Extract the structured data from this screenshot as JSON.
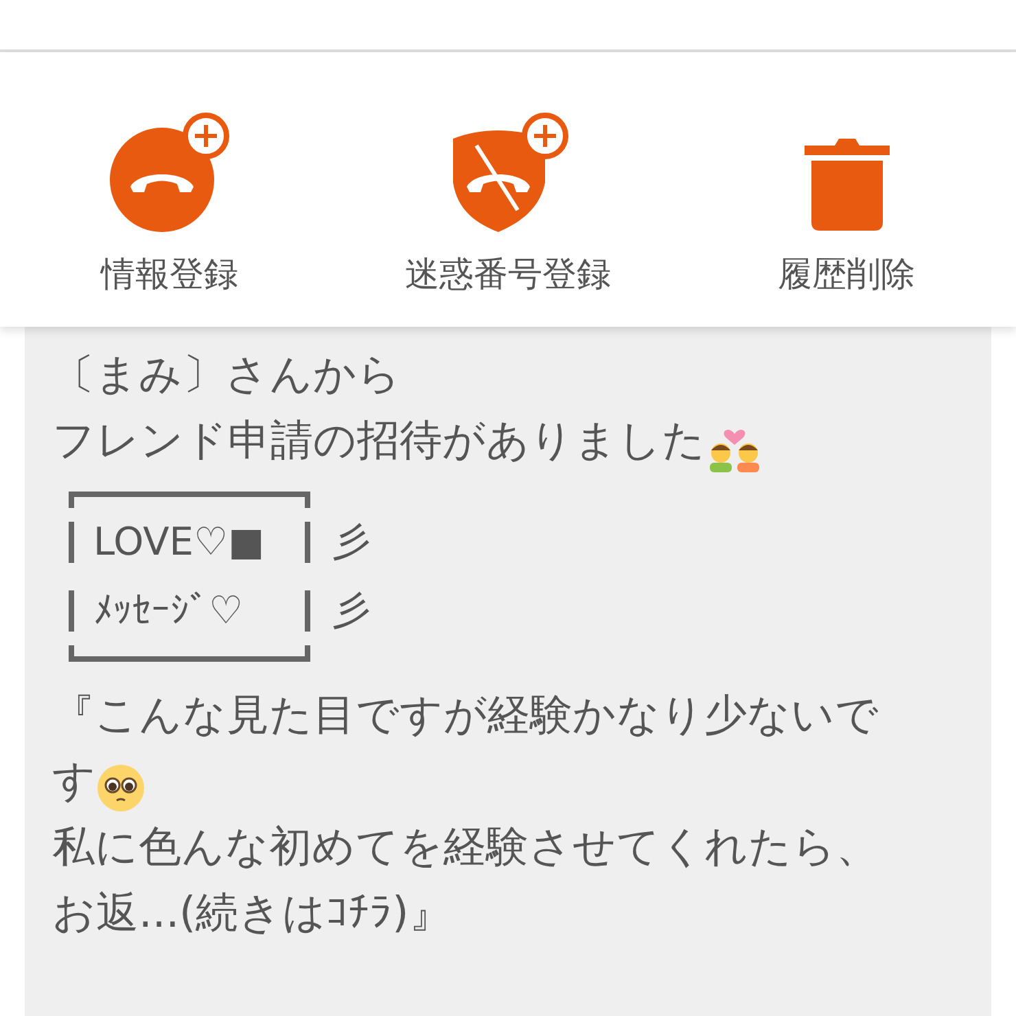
{
  "actions": [
    {
      "kind": "add-contact",
      "label": "情報登録"
    },
    {
      "kind": "block-number",
      "label": "迷惑番号登録"
    },
    {
      "kind": "delete-history",
      "label": "履歴削除"
    }
  ],
  "message": [
    {
      "kind": "text",
      "text": "〔まみ〕さんから"
    },
    {
      "kind": "text",
      "text": "フレンド申請の招待がありました",
      "trailing": {
        "kind": "couple"
      }
    },
    {
      "kind": "frame",
      "rows": [
        {
          "text": "LOVE♡■",
          "side": "彡"
        },
        {
          "text": "ﾒｯｾｰｼﾞ♡",
          "side": "彡"
        }
      ]
    },
    {
      "kind": "text",
      "text": "『こんな見た目ですが経験かなり少ないで"
    },
    {
      "kind": "text",
      "text": "す",
      "trailing": {
        "kind": "pleading"
      }
    },
    {
      "kind": "text",
      "text": "私に色んな初めてを経験させてくれたら、"
    },
    {
      "kind": "text",
      "text": "お返...(続きはｺﾁﾗ)』"
    }
  ]
}
